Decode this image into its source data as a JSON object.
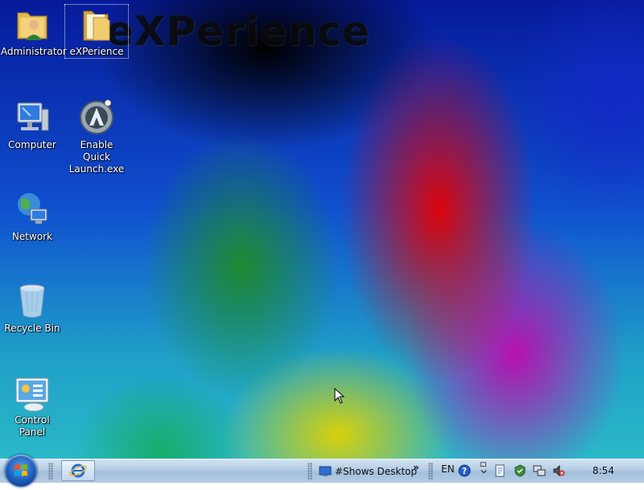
{
  "wallpaper": {
    "brand_text": "eXPerience"
  },
  "desktop_icons": [
    {
      "id": "administrator",
      "label": "Administrator",
      "icon": "user-folder-icon"
    },
    {
      "id": "experience",
      "label": "eXPerience",
      "icon": "folder-icon",
      "selected": true
    },
    {
      "id": "computer",
      "label": "Computer",
      "icon": "computer-icon"
    },
    {
      "id": "enable-quick-launch",
      "label": "Enable Quick Launch.exe",
      "icon": "autoit-exe-icon"
    },
    {
      "id": "network",
      "label": "Network",
      "icon": "network-globe-icon"
    },
    {
      "id": "recycle-bin",
      "label": "Recycle Bin",
      "icon": "recycle-bin-icon"
    },
    {
      "id": "control-panel",
      "label": "Control Panel",
      "icon": "control-panel-icon"
    }
  ],
  "taskbar": {
    "start_icon": "windows-orb-icon",
    "tasks": [
      {
        "id": "internet-explorer",
        "icon": "internet-explorer-icon"
      }
    ],
    "toolbar_label": "#Shows Desktop",
    "toolbar_overflow": "»",
    "language": "EN",
    "tray_icons": [
      "help-icon",
      "restore-icon",
      "document-icon",
      "security-shield-icon",
      "network-connection-icon",
      "volume-muted-icon"
    ],
    "clock": "8:54"
  },
  "colors": {
    "taskbar_top": "#d3e4f3",
    "taskbar_bottom": "#a2bfdc",
    "icon_label": "#ffffff"
  }
}
